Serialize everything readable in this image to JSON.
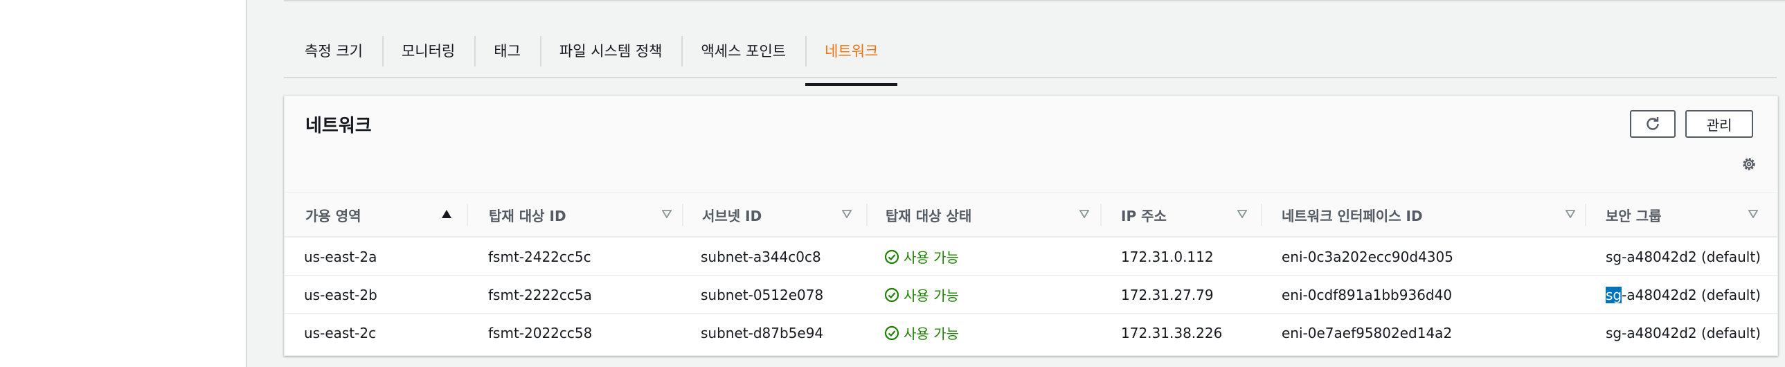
{
  "tabs": [
    {
      "label": "측정 크기",
      "active": false
    },
    {
      "label": "모니터링",
      "active": false
    },
    {
      "label": "태그",
      "active": false
    },
    {
      "label": "파일 시스템 정책",
      "active": false
    },
    {
      "label": "액세스 포인트",
      "active": false
    },
    {
      "label": "네트워크",
      "active": true
    }
  ],
  "panel": {
    "title": "네트워크",
    "manage_label": "관리",
    "refresh_icon": "refresh-icon",
    "settings_icon": "gear-icon"
  },
  "table": {
    "columns": [
      {
        "label": "가용 영역",
        "sort": "ascending"
      },
      {
        "label": "탑재 대상 ID",
        "sort": "none"
      },
      {
        "label": "서브넷 ID",
        "sort": "none"
      },
      {
        "label": "탑재 대상 상태",
        "sort": "none"
      },
      {
        "label": "IP 주소",
        "sort": "none"
      },
      {
        "label": "네트워크 인터페이스 ID",
        "sort": "none"
      },
      {
        "label": "보안 그룹",
        "sort": "none"
      }
    ],
    "rows": [
      {
        "az": "us-east-2a",
        "mount_target_id": "fsmt-2422cc5c",
        "subnet_id": "subnet-a344c0c8",
        "status": "사용 가능",
        "ip": "172.31.0.112",
        "eni": "eni-0c3a202ecc90d4305",
        "sg_prefix": "",
        "sg_highlight": "",
        "sg": "sg-a48042d2 (default)"
      },
      {
        "az": "us-east-2b",
        "mount_target_id": "fsmt-2222cc5a",
        "subnet_id": "subnet-0512e078",
        "status": "사용 가능",
        "ip": "172.31.27.79",
        "eni": "eni-0cdf891a1bb936d40",
        "sg_prefix": "",
        "sg_highlight": "sg",
        "sg": "-a48042d2 (default)"
      },
      {
        "az": "us-east-2c",
        "mount_target_id": "fsmt-2022cc58",
        "subnet_id": "subnet-d87b5e94",
        "status": "사용 가능",
        "ip": "172.31.38.226",
        "eni": "eni-0e7aef95802ed14a2",
        "sg_prefix": "",
        "sg_highlight": "",
        "sg": "sg-a48042d2 (default)"
      }
    ]
  },
  "colors": {
    "accent": "#ec7211",
    "status_ok": "#1d8102",
    "text_selection": "#0073bb"
  }
}
